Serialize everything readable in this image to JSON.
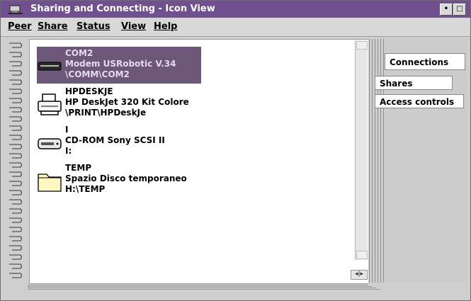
{
  "window": {
    "title": "Sharing and Connecting - Icon View",
    "controls": {
      "minimize": "•",
      "maximize": "□"
    }
  },
  "menubar": {
    "items": [
      {
        "label": "Peer"
      },
      {
        "label": "Share"
      },
      {
        "label": "Status"
      },
      {
        "label": "View"
      },
      {
        "label": "Help"
      }
    ]
  },
  "items": [
    {
      "name": "COM2",
      "description": "Modem USRobotic V.34",
      "path": "\\COMM\\COM2",
      "icon": "modem-icon",
      "selected": true
    },
    {
      "name": "HPDESKJE",
      "description": "HP DeskJet 320 Kit Colore",
      "path": "\\PRINT\\HPDeskJe",
      "icon": "printer-icon",
      "selected": false
    },
    {
      "name": "I",
      "description": "CD-ROM Sony SCSI II",
      "path": "I:",
      "icon": "cdrom-drive-icon",
      "selected": false
    },
    {
      "name": "TEMP",
      "description": "Spazio Disco temporaneo",
      "path": "H:\\TEMP",
      "icon": "folder-icon",
      "selected": false
    }
  ],
  "tabs": [
    {
      "label": "Connections"
    },
    {
      "label": "Shares"
    },
    {
      "label": "Access controls"
    }
  ],
  "pager": {
    "label": "◂|▸"
  },
  "colors": {
    "titlebar": "#70508f",
    "selection": "#6e587a"
  }
}
